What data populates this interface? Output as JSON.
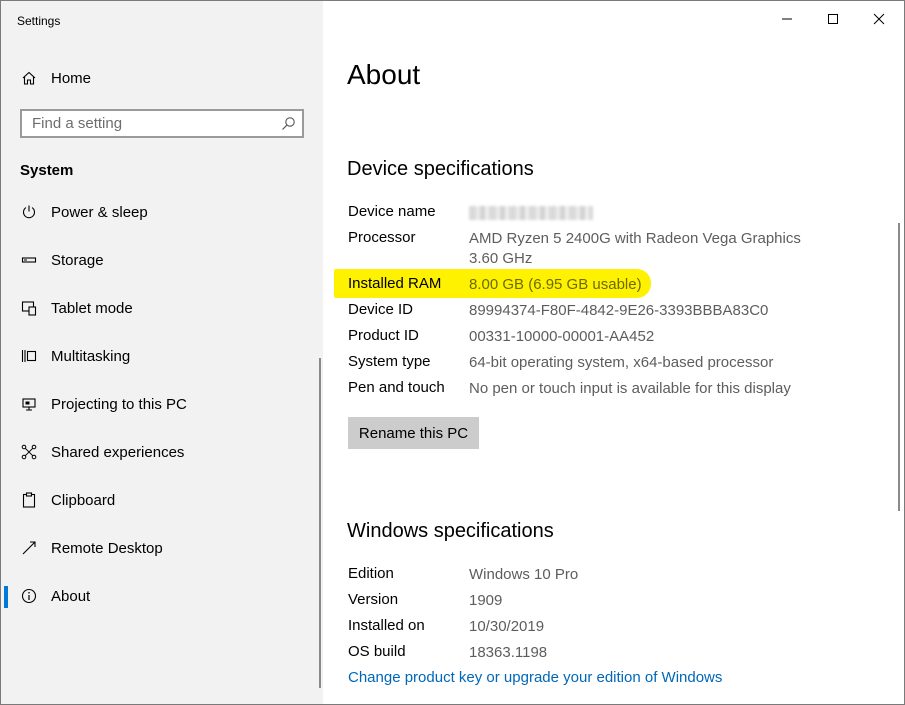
{
  "window": {
    "app_title": "Settings",
    "controls": [
      {
        "name": "minimize-button",
        "icon": "minimize-icon"
      },
      {
        "name": "maximize-button",
        "icon": "maximize-icon"
      },
      {
        "name": "close-button",
        "icon": "close-icon"
      }
    ]
  },
  "sidebar": {
    "home": {
      "label": "Home",
      "icon": "home-icon"
    },
    "search": {
      "placeholder": "Find a setting",
      "icon": "search-icon"
    },
    "section": "System",
    "items": [
      {
        "label": "Power & sleep",
        "icon": "power-icon"
      },
      {
        "label": "Storage",
        "icon": "storage-icon"
      },
      {
        "label": "Tablet mode",
        "icon": "tablet-mode-icon"
      },
      {
        "label": "Multitasking",
        "icon": "multitasking-icon"
      },
      {
        "label": "Projecting to this PC",
        "icon": "projecting-icon"
      },
      {
        "label": "Shared experiences",
        "icon": "shared-experiences-icon"
      },
      {
        "label": "Clipboard",
        "icon": "clipboard-icon"
      },
      {
        "label": "Remote Desktop",
        "icon": "remote-desktop-icon"
      },
      {
        "label": "About",
        "icon": "info-icon",
        "selected": true
      }
    ]
  },
  "main": {
    "title": "About",
    "device_specs": {
      "heading": "Device specifications",
      "rows": [
        {
          "key": "Device name",
          "value": ""
        },
        {
          "key": "Processor",
          "value": "AMD Ryzen 5 2400G with Radeon Vega Graphics",
          "value_line2": "3.60 GHz"
        },
        {
          "key": "Installed RAM",
          "value": "8.00 GB (6.95 GB usable)"
        },
        {
          "key": "Device ID",
          "value": "89994374-F80F-4842-9E26-3393BBBA83C0"
        },
        {
          "key": "Product ID",
          "value": "00331-10000-00001-AA452"
        },
        {
          "key": "System type",
          "value": "64-bit operating system, x64-based processor"
        },
        {
          "key": "Pen and touch",
          "value": "No pen or touch input is available for this display"
        }
      ],
      "rename_button": "Rename this PC"
    },
    "windows_specs": {
      "heading": "Windows specifications",
      "rows": [
        {
          "key": "Edition",
          "value": "Windows 10 Pro"
        },
        {
          "key": "Version",
          "value": "1909"
        },
        {
          "key": "Installed on",
          "value": "10/30/2019"
        },
        {
          "key": "OS build",
          "value": "18363.1198"
        }
      ],
      "link": "Change product key or upgrade your edition of Windows"
    }
  },
  "colors": {
    "accent": "#0078d7",
    "link": "#0067b8",
    "highlight": "#fff200",
    "sidebar_bg": "#f2f2f2",
    "value_text": "#5d5d5d"
  }
}
